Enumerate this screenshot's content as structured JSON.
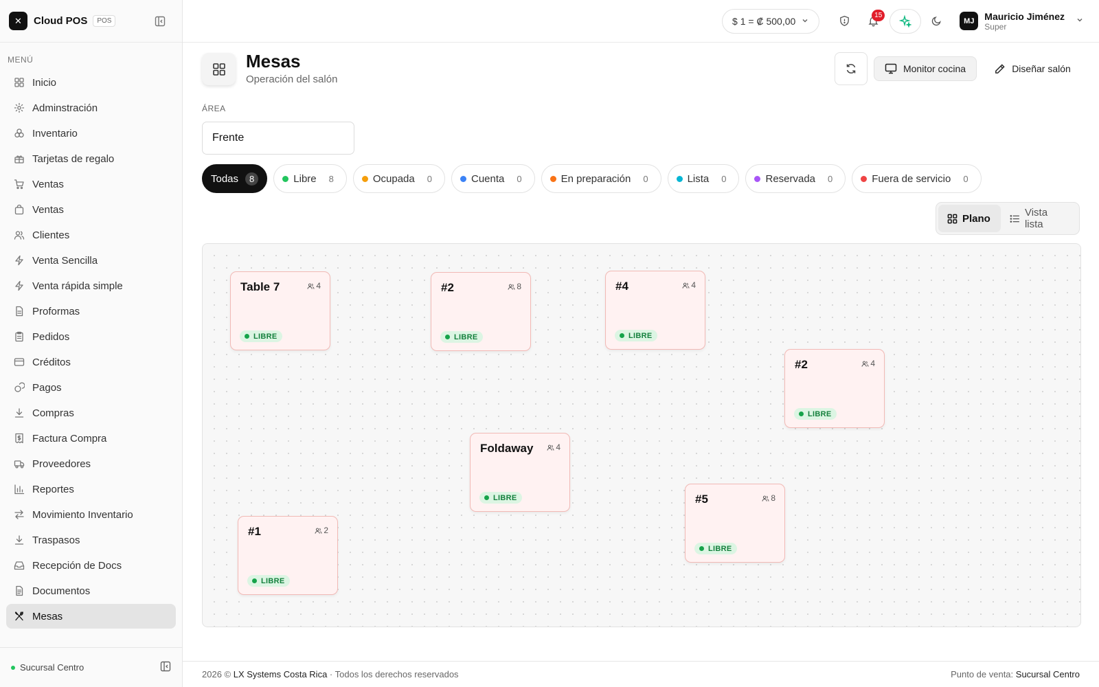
{
  "app": {
    "name": "Cloud POS",
    "badge": "POS"
  },
  "sidebar": {
    "heading": "MENÚ",
    "items": [
      {
        "label": "Inicio",
        "icon": "grid-icon"
      },
      {
        "label": "Adminstración",
        "icon": "gear-icon"
      },
      {
        "label": "Inventario",
        "icon": "boxes-icon"
      },
      {
        "label": "Tarjetas de regalo",
        "icon": "gift-icon"
      },
      {
        "label": "Ventas",
        "icon": "cart-icon"
      },
      {
        "label": "Ventas",
        "icon": "bag-icon"
      },
      {
        "label": "Clientes",
        "icon": "users-icon"
      },
      {
        "label": "Venta Sencilla",
        "icon": "bolt-icon"
      },
      {
        "label": "Venta rápida simple",
        "icon": "bolt-icon"
      },
      {
        "label": "Proformas",
        "icon": "file-icon"
      },
      {
        "label": "Pedidos",
        "icon": "clipboard-icon"
      },
      {
        "label": "Créditos",
        "icon": "card-icon"
      },
      {
        "label": "Pagos",
        "icon": "coins-icon"
      },
      {
        "label": "Compras",
        "icon": "download-icon"
      },
      {
        "label": "Factura Compra",
        "icon": "receipt-icon"
      },
      {
        "label": "Proveedores",
        "icon": "truck-icon"
      },
      {
        "label": "Reportes",
        "icon": "bar-chart-icon"
      },
      {
        "label": "Movimiento Inventario",
        "icon": "arrows-icon"
      },
      {
        "label": "Traspasos",
        "icon": "download-icon"
      },
      {
        "label": "Recepción de Docs",
        "icon": "inbox-icon"
      },
      {
        "label": "Documentos",
        "icon": "document-icon"
      },
      {
        "label": "Mesas",
        "icon": "utensils-icon",
        "active": true
      }
    ],
    "branch": "Sucursal Centro"
  },
  "header": {
    "currency": "$ 1 =  ₡ 500,00",
    "notifications": "15",
    "user": {
      "initials": "MJ",
      "name": "Mauricio Jiménez",
      "role": "Super"
    }
  },
  "page": {
    "title": "Mesas",
    "subtitle": "Operación del salón",
    "kitchen_button": "Monitor cocina",
    "design_button": "Diseñar salón",
    "area_label": "ÁREA",
    "area_value": "Frente"
  },
  "filters": [
    {
      "label": "Todas",
      "count": "8",
      "color": "",
      "active": true
    },
    {
      "label": "Libre",
      "count": "8",
      "color": "#22c55e"
    },
    {
      "label": "Ocupada",
      "count": "0",
      "color": "#f59e0b"
    },
    {
      "label": "Cuenta",
      "count": "0",
      "color": "#3b82f6"
    },
    {
      "label": "En preparación",
      "count": "0",
      "color": "#f97316"
    },
    {
      "label": "Lista",
      "count": "0",
      "color": "#06b6d4"
    },
    {
      "label": "Reservada",
      "count": "0",
      "color": "#a855f7"
    },
    {
      "label": "Fuera de servicio",
      "count": "0",
      "color": "#ef4444"
    }
  ],
  "view_toggle": {
    "plan": "Plano",
    "list": "Vista lista"
  },
  "tables": [
    {
      "name": "Table 7",
      "capacity": "4",
      "status": "LIBRE"
    },
    {
      "name": "#2",
      "capacity": "8",
      "status": "LIBRE"
    },
    {
      "name": "#4",
      "capacity": "4",
      "status": "LIBRE"
    },
    {
      "name": "#2",
      "capacity": "4",
      "status": "LIBRE"
    },
    {
      "name": "Foldaway",
      "capacity": "4",
      "status": "LIBRE"
    },
    {
      "name": "#5",
      "capacity": "8",
      "status": "LIBRE"
    },
    {
      "name": "#1",
      "capacity": "2",
      "status": "LIBRE"
    }
  ],
  "footer": {
    "copyright": "2026 ©",
    "company": "LX Systems Costa Rica",
    "rights": "· Todos los derechos reservados",
    "pos_label": "Punto de venta:",
    "pos_value": "Sucursal Centro"
  }
}
